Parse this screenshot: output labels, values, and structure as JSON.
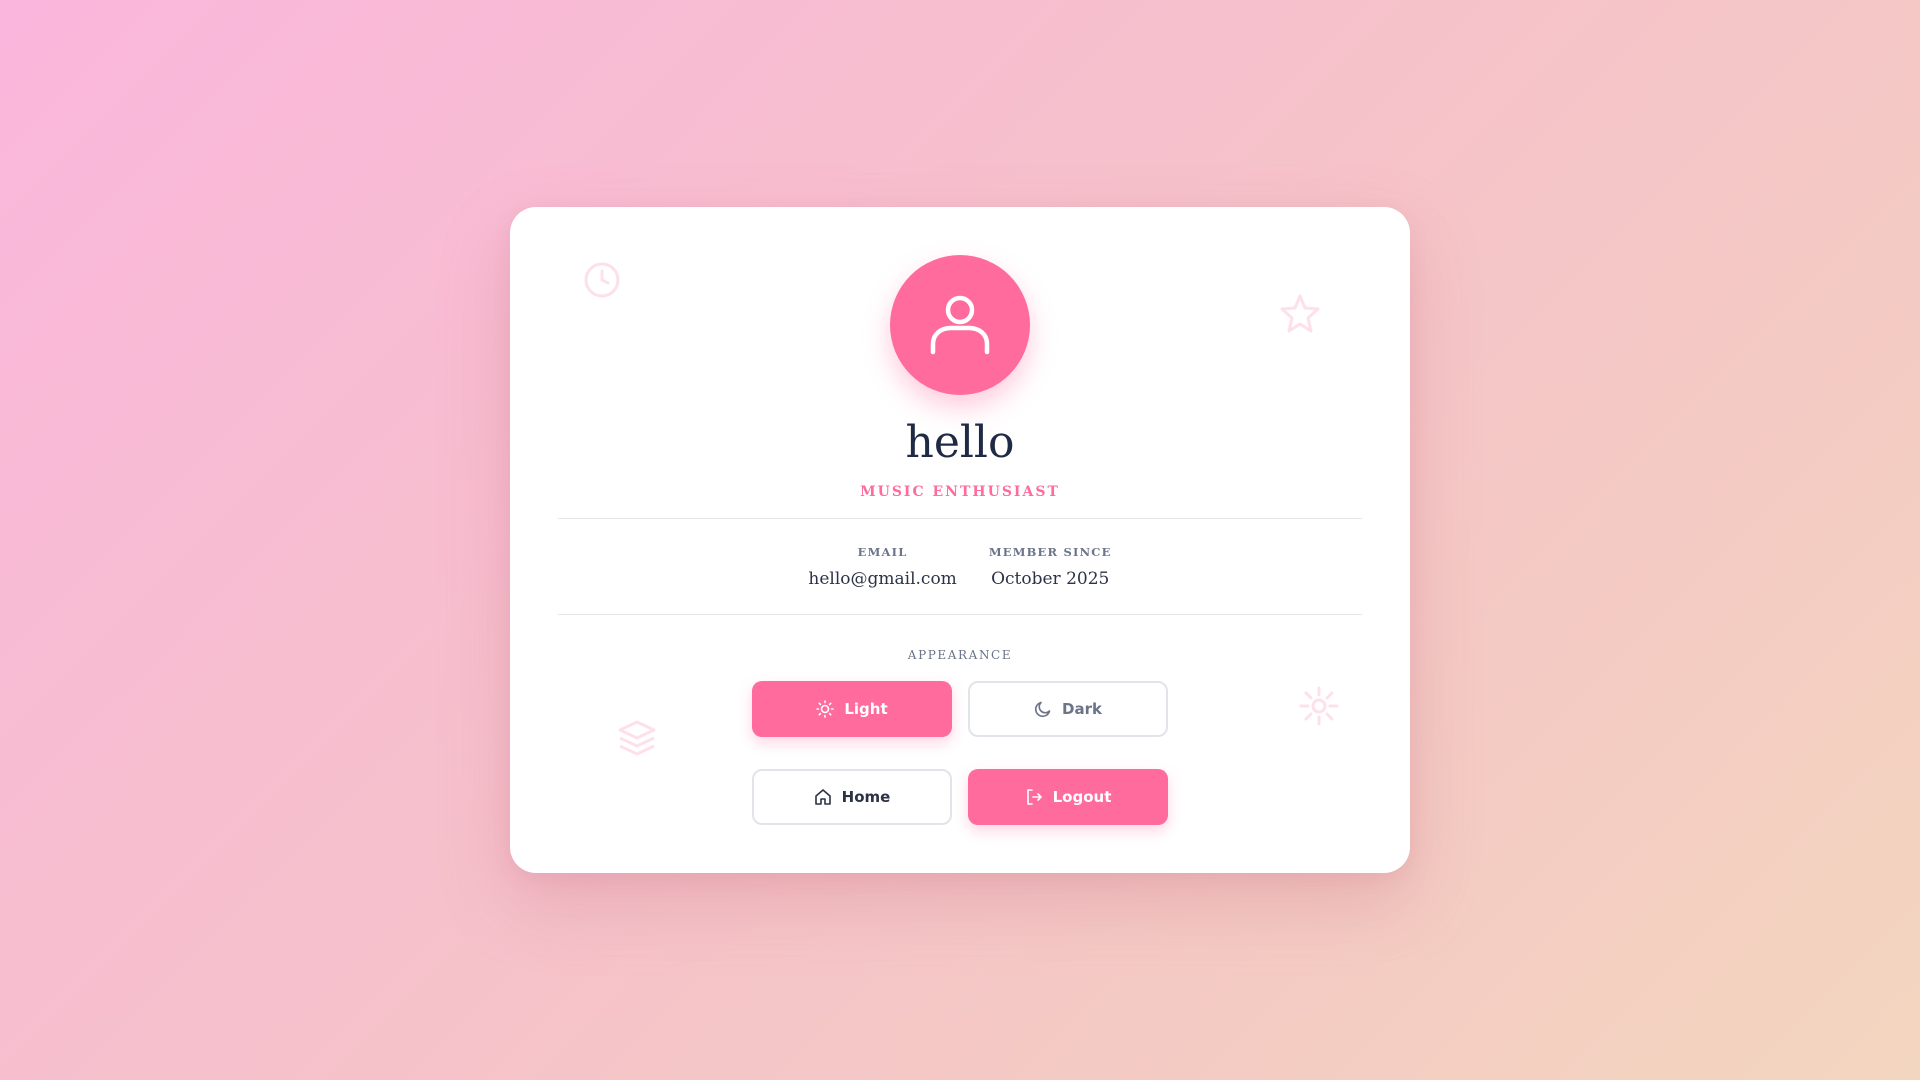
{
  "profile": {
    "name": "hello",
    "title": "MUSIC ENTHUSIAST",
    "avatar_icon": "user-icon"
  },
  "info": {
    "email_label": "EMAIL",
    "email_value": "hello@gmail.com",
    "member_label": "MEMBER SINCE",
    "member_value": "October 2025"
  },
  "appearance": {
    "label": "APPEARANCE",
    "light_label": "Light",
    "dark_label": "Dark",
    "selected": "Light"
  },
  "actions": {
    "home_label": "Home",
    "logout_label": "Logout"
  },
  "colors": {
    "accent": "#ff6b9d",
    "text_dark": "#1f2a44",
    "text_muted": "#6b7488"
  },
  "decorations": [
    "clock-icon",
    "star-icon",
    "layers-icon",
    "sun-icon"
  ]
}
